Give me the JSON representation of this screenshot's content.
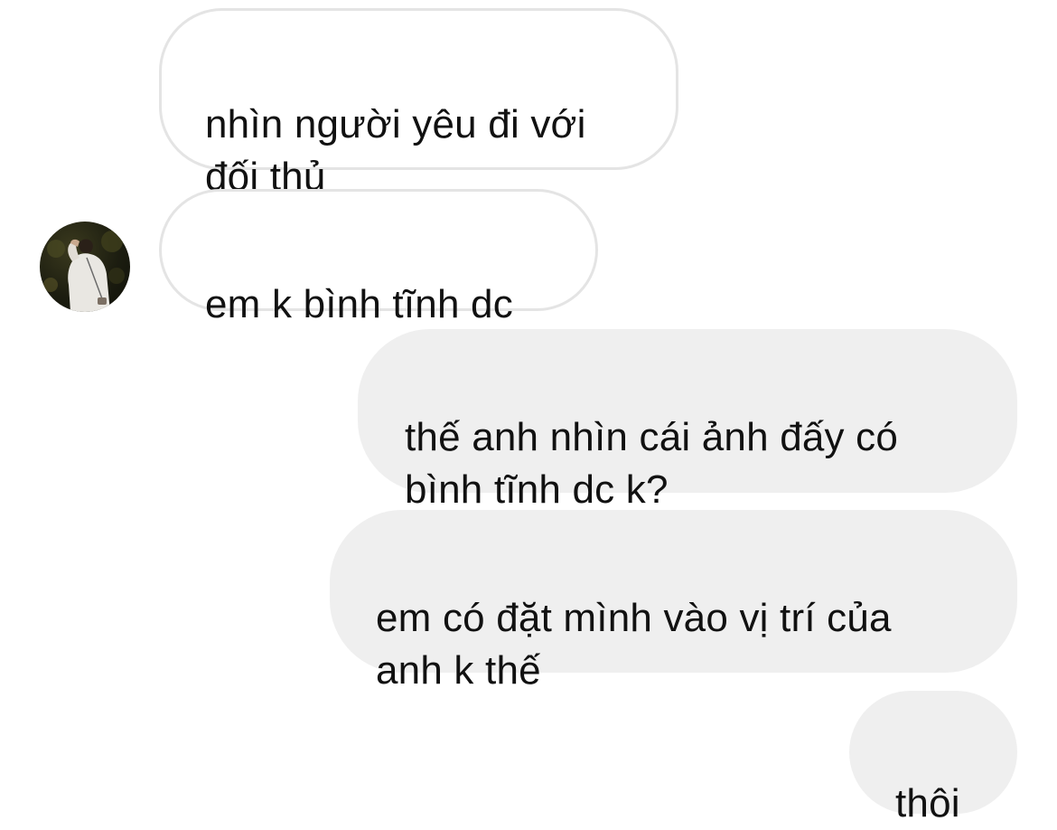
{
  "thread": {
    "messages": [
      {
        "sender": "other",
        "text": "nhìn người yêu đi với\nđối thủ"
      },
      {
        "sender": "other",
        "text": "em k bình tĩnh dc"
      },
      {
        "sender": "me",
        "text": "thế anh nhìn cái ảnh đấy có\nbình tĩnh dc k?"
      },
      {
        "sender": "me",
        "text": "em có đặt mình vào vị trí của\nanh k thế"
      },
      {
        "sender": "me",
        "text": "thôi"
      }
    ]
  },
  "colors": {
    "incoming_bubble_border": "#e4e4e4",
    "outgoing_bubble_bg": "#efefef",
    "text": "#111111",
    "background": "#ffffff"
  },
  "icons": {
    "avatar": "contact-avatar-photo"
  }
}
